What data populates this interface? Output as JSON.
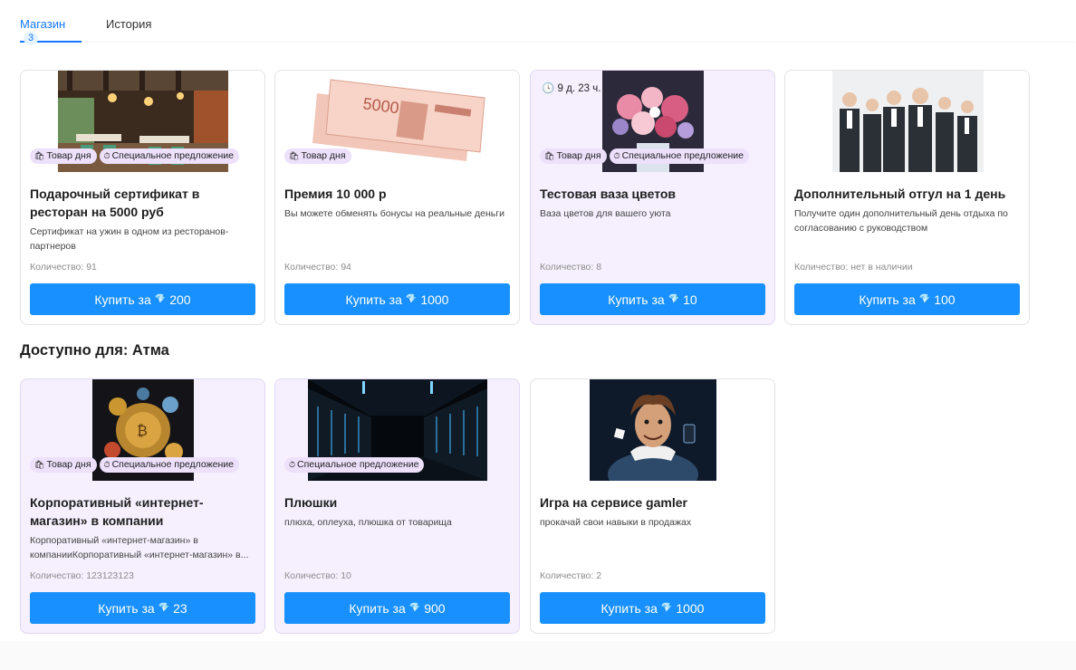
{
  "tabs": {
    "shop_label": "Магазин",
    "shop_count": "3",
    "history_label": "История"
  },
  "tags": {
    "day": "Товар дня",
    "special": "Специальное предложение"
  },
  "icons": {
    "bag": "shopping-bag-icon",
    "timer": "timer-icon",
    "clock": "clock-icon",
    "gem": "diamond-icon"
  },
  "colors": {
    "accent": "#1890ff",
    "lilac": "#f6f0fe",
    "tag_bg": "#ede0fb"
  },
  "section": {
    "title": "Доступно для: Атма"
  },
  "cards": [
    {
      "title": "Подарочный сертификат в ресторан на 5000 руб",
      "description": "Сертификат на ужин в одном из ресторанов-партнеров",
      "quantity": "Количество: 91",
      "buy_prefix": "Купить за",
      "price": "200"
    },
    {
      "title": "Премия 10 000 р",
      "description": "Вы можете обменять бонусы на реальные деньги",
      "quantity": "Количество: 94",
      "buy_prefix": "Купить за",
      "price": "1000"
    },
    {
      "timer": "9 д. 23 ч.",
      "title": "Тестовая ваза цветов",
      "description": "Ваза цветов для вашего уюта",
      "quantity": "Количество: 8",
      "buy_prefix": "Купить за",
      "price": "10"
    },
    {
      "title": "Дополнительный отгул на 1 день",
      "description": "Получите один дополнительный день отдыха по согласованию с руководством",
      "quantity": "Количество: нет в наличии",
      "buy_prefix": "Купить за",
      "price": "100"
    },
    {
      "title": "Корпоративный «интернет-магазин» в компании",
      "description": "Корпоративный «интернет-магазин» в компанииКорпоративный «интернет-магазин» в...",
      "quantity": "Количество: 123123123",
      "buy_prefix": "Купить за",
      "price": "23"
    },
    {
      "title": "Плюшки",
      "description": "плюха, оплеуха, плюшка от товарища",
      "quantity": "Количество: 10",
      "buy_prefix": "Купить за",
      "price": "900"
    },
    {
      "title": "Игра на сервисе gamler",
      "description": "прокачай свои навыки в продажах",
      "quantity": "Количество: 2",
      "buy_prefix": "Купить за",
      "price": "1000"
    }
  ]
}
